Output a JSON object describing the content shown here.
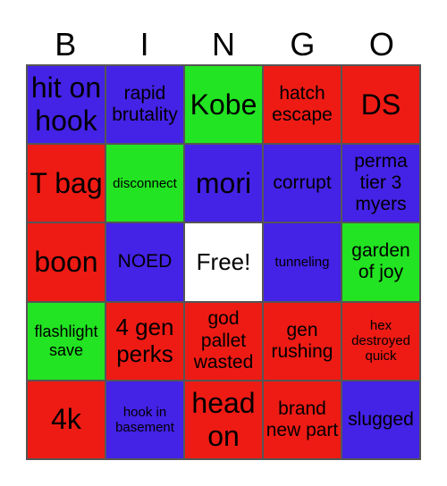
{
  "header": [
    "B",
    "I",
    "N",
    "G",
    "O"
  ],
  "colors": {
    "red": "#ee1b14",
    "blue": "#4422e6",
    "green": "#22e422",
    "white": "#ffffff"
  },
  "cells": [
    {
      "text": "hit on hook",
      "color": "blue"
    },
    {
      "text": "rapid brutality",
      "color": "blue"
    },
    {
      "text": "Kobe",
      "color": "green"
    },
    {
      "text": "hatch escape",
      "color": "red"
    },
    {
      "text": "DS",
      "color": "red"
    },
    {
      "text": "T bag",
      "color": "red"
    },
    {
      "text": "disconnect",
      "color": "green"
    },
    {
      "text": "mori",
      "color": "blue"
    },
    {
      "text": "corrupt",
      "color": "blue"
    },
    {
      "text": "perma tier 3 myers",
      "color": "blue"
    },
    {
      "text": "boon",
      "color": "red"
    },
    {
      "text": "NOED",
      "color": "blue"
    },
    {
      "text": "Free!",
      "color": "white"
    },
    {
      "text": "tunneling",
      "color": "blue"
    },
    {
      "text": "garden of joy",
      "color": "green"
    },
    {
      "text": "flashlight save",
      "color": "green"
    },
    {
      "text": "4 gen perks",
      "color": "red"
    },
    {
      "text": "god pallet wasted",
      "color": "red"
    },
    {
      "text": "gen rushing",
      "color": "red"
    },
    {
      "text": "hex destroyed quick",
      "color": "red"
    },
    {
      "text": "4k",
      "color": "red"
    },
    {
      "text": "hook in basement",
      "color": "blue"
    },
    {
      "text": "head on",
      "color": "red"
    },
    {
      "text": "brand new part",
      "color": "red"
    },
    {
      "text": "slugged",
      "color": "blue"
    }
  ]
}
